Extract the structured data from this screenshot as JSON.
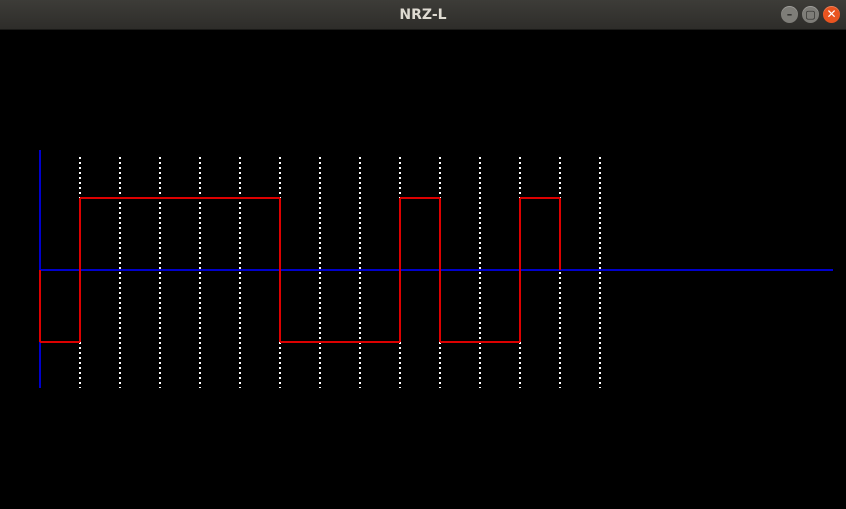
{
  "window": {
    "title": "NRZ-L",
    "controls": {
      "minimize_icon": "minimize-icon",
      "maximize_icon": "maximize-icon",
      "close_icon": "close-icon"
    }
  },
  "chart_data": {
    "type": "line",
    "encoding": "NRZ-L",
    "bits": [
      1,
      0,
      0,
      0,
      0,
      0,
      1,
      1,
      1,
      0,
      1,
      1,
      0,
      1
    ],
    "levels": [
      -1,
      1,
      1,
      1,
      1,
      1,
      -1,
      -1,
      -1,
      1,
      -1,
      -1,
      1,
      0
    ],
    "ylim": [
      -1.7,
      1.7
    ],
    "bit_boundary_markers": 14,
    "colors": {
      "signal": "#dd0000",
      "axes": "#0000cc",
      "grid": "#ffffff",
      "background": "#000000"
    },
    "grid": "dotted-vertical"
  }
}
